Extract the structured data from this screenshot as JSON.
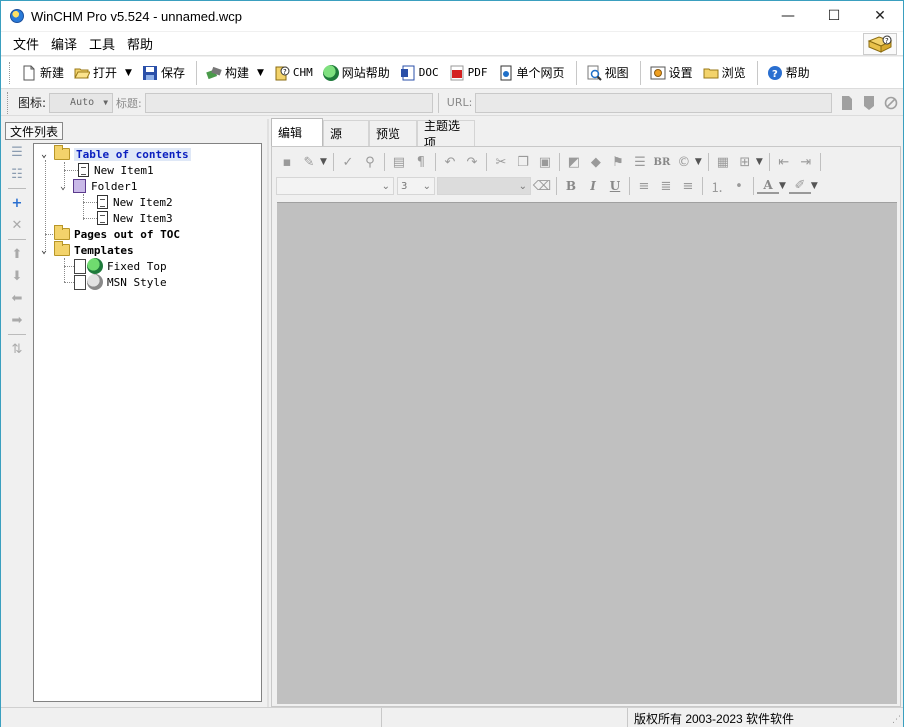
{
  "window": {
    "title": "WinCHM Pro v5.524 - unnamed.wcp",
    "minimize": "—",
    "maximize": "☐",
    "close": "✕"
  },
  "menu": [
    "文件",
    "编译",
    "工具",
    "帮助"
  ],
  "toolbar": {
    "new": "新建",
    "open": "打开",
    "save": "保存",
    "build": "构建",
    "chm": "CHM",
    "web_help": "网站帮助",
    "doc": "DOC",
    "pdf": "PDF",
    "single_page": "单个网页",
    "view": "视图",
    "settings": "设置",
    "browse": "浏览",
    "help": "帮助"
  },
  "propbar": {
    "icon_label": "图标:",
    "icon_value": "Auto",
    "title_label": "标题:",
    "title_value": "",
    "url_label": "URL:",
    "url_value": ""
  },
  "filelist": {
    "tab_label": "文件列表",
    "tree": {
      "toc": "Table of contents",
      "item1": "New Item1",
      "folder1": "Folder1",
      "item2": "New Item2",
      "item3": "New Item3",
      "pages_out": "Pages out of TOC",
      "templates": "Templates",
      "fixed_top": "Fixed Top",
      "msn_style": "MSN Style"
    }
  },
  "editor": {
    "tabs": [
      "编辑",
      "源",
      "预览",
      "主题选项"
    ],
    "active_tab": "编辑",
    "font_size_value": "3",
    "br_label": "BR",
    "bold": "B",
    "italic": "I",
    "underline": "U",
    "font_color": "A"
  },
  "status": {
    "copyright": "版权所有 2003-2023 软件软件"
  },
  "colors": {
    "window_border": "#3a9fbf",
    "canvas": "#c0c0c0",
    "selected_text": "#0a1fbf"
  }
}
